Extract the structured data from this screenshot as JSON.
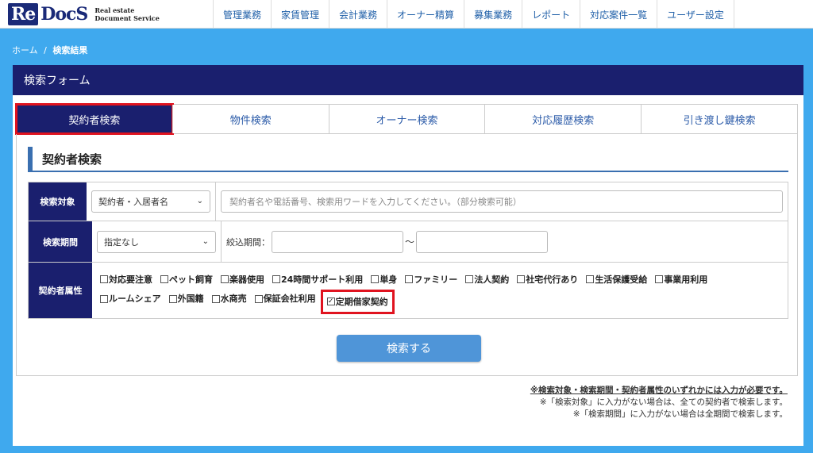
{
  "logo": {
    "part1": "Re",
    "part2": "DocS",
    "line1": "Real estate",
    "line2": "Document Service"
  },
  "nav": [
    "管理業務",
    "家賃管理",
    "会計業務",
    "オーナー精算",
    "募集業務",
    "レポート",
    "対応案件一覧",
    "ユーザー設定"
  ],
  "breadcrumb": {
    "home": "ホーム",
    "sep": "/",
    "current": "検索結果"
  },
  "panel": {
    "title": "検索フォーム"
  },
  "tabs": [
    "契約者検索",
    "物件検索",
    "オーナー検索",
    "対応履歴検索",
    "引き渡し鍵検索"
  ],
  "section": {
    "title": "契約者検索"
  },
  "form": {
    "target_label": "検索対象",
    "target_select": "契約者・入居者名",
    "target_placeholder": "契約者名や電話番号、検索用ワードを入力してください。（部分検索可能）",
    "period_label": "検索期間",
    "period_select": "指定なし",
    "period_narrow_label": "絞込期間：",
    "period_tilde": "～",
    "attr_label": "契約者属性",
    "attributes": [
      {
        "label": "対応要注意",
        "checked": false
      },
      {
        "label": "ペット飼育",
        "checked": false
      },
      {
        "label": "楽器使用",
        "checked": false
      },
      {
        "label": "24時間サポート利用",
        "checked": false
      },
      {
        "label": "単身",
        "checked": false
      },
      {
        "label": "ファミリー",
        "checked": false
      },
      {
        "label": "法人契約",
        "checked": false
      },
      {
        "label": "社宅代行あり",
        "checked": false
      },
      {
        "label": "生活保護受給",
        "checked": false
      },
      {
        "label": "事業用利用",
        "checked": false
      },
      {
        "label": "ルームシェア",
        "checked": false
      },
      {
        "label": "外国籍",
        "checked": false
      },
      {
        "label": "水商売",
        "checked": false
      },
      {
        "label": "保証会社利用",
        "checked": false
      },
      {
        "label": "定期借家契約",
        "checked": true
      }
    ],
    "search_button": "検索する"
  },
  "notes": [
    "※検索対象・検索期間・契約者属性のいずれかには入力が必要です。",
    "※「検索対象」に入力がない場合は、全ての契約者で検索します。",
    "※「検索期間」に入力がない場合は全期間で検索します。"
  ]
}
